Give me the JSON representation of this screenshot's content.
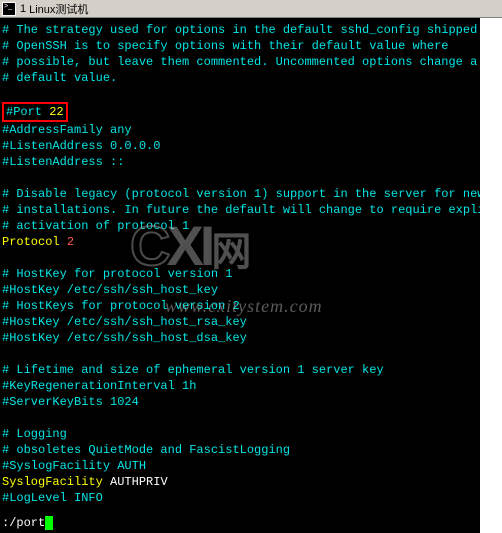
{
  "tab": {
    "number": "1",
    "title": "Linux测试机"
  },
  "lines": {
    "c1": "# The strategy used for options in the default sshd_config shipped with",
    "c2": "# OpenSSH is to specify options with their default value where",
    "c3": "# possible, but leave them commented. Uncommented options change a",
    "c4": "# default value.",
    "port_label": "#Port ",
    "port_value": "22",
    "af": "#AddressFamily any",
    "la1": "#ListenAddress 0.0.0.0",
    "la2": "#ListenAddress ::",
    "leg1": "# Disable legacy (protocol version 1) support in the server for new",
    "leg2": "# installations. In future the default will change to require explicit",
    "leg3": "# activation of protocol 1",
    "proto_k": "Protocol ",
    "proto_v": "2",
    "hk1": "# HostKey for protocol version 1",
    "hk2": "#HostKey /etc/ssh/ssh_host_key",
    "hk3": "# HostKeys for protocol version 2",
    "hk4": "#HostKey /etc/ssh/ssh_host_rsa_key",
    "hk5": "#HostKey /etc/ssh/ssh_host_dsa_key",
    "life1": "# Lifetime and size of ephemeral version 1 server key",
    "life2": "#KeyRegenerationInterval 1h",
    "life3": "#ServerKeyBits 1024",
    "log1": "# Logging",
    "log2": "# obsoletes QuietMode and FascistLogging",
    "log3": "#SyslogFacility AUTH",
    "sf_k": "SyslogFacility ",
    "sf_v": "AUTHPRIV",
    "ll": "#LogLevel INFO"
  },
  "search": {
    "prefix": ":/",
    "query": "port"
  },
  "watermark": {
    "brand": "CXI网",
    "sub": "www.cxitystem.com"
  }
}
